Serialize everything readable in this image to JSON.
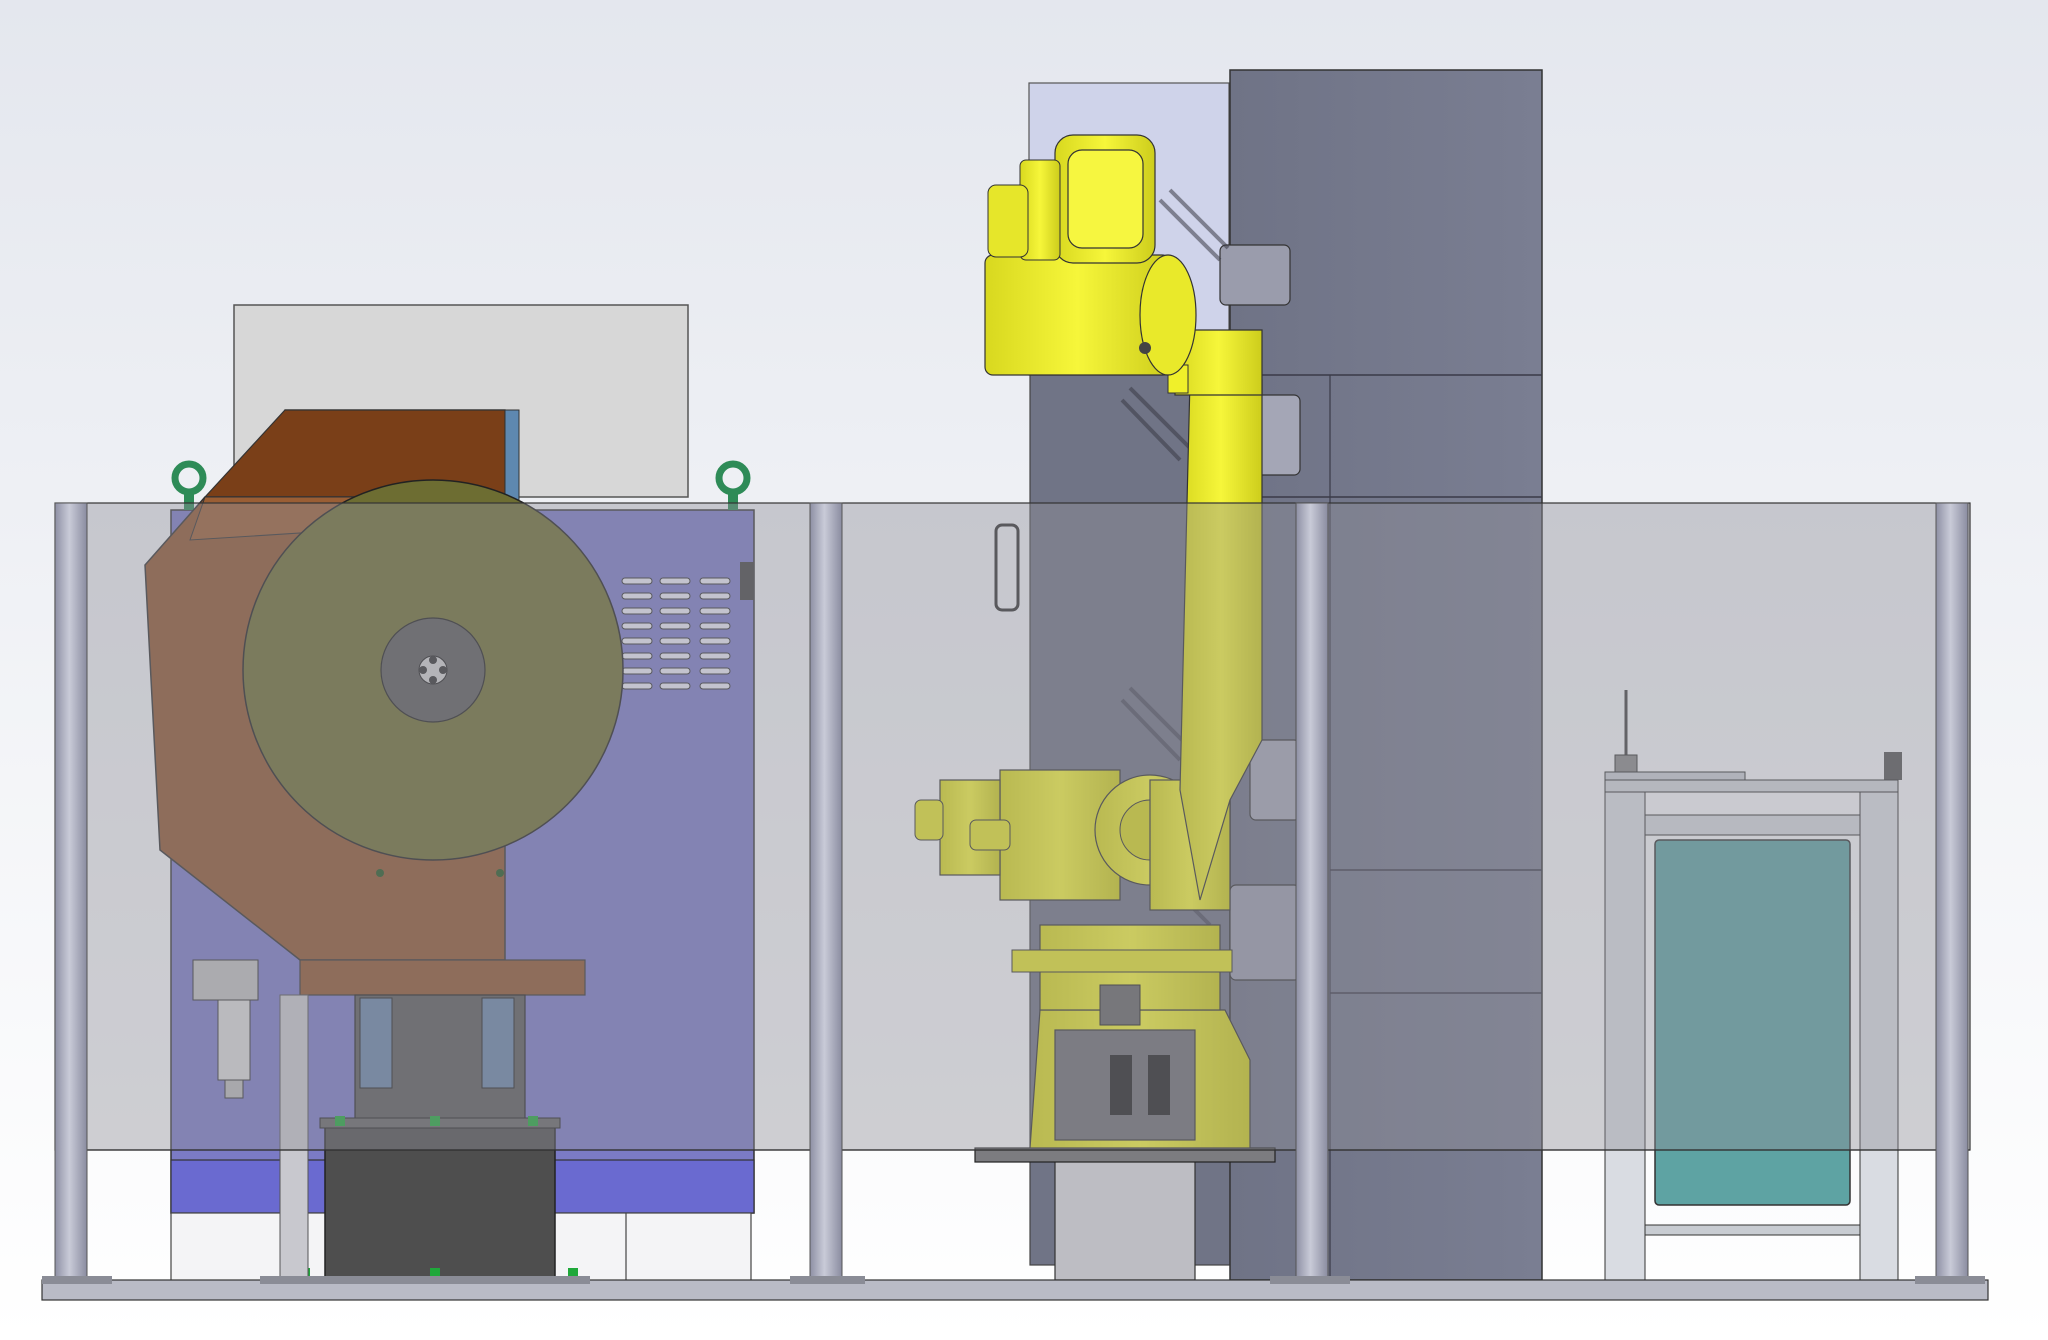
{
  "scene": {
    "description_shown": "",
    "colors": {
      "background_top": "#e6e9ef",
      "background_bottom": "#ffffff",
      "guard_panel": "#9ea0a8",
      "guard_post": "#a4a6b8",
      "press_cabinet": "#7b7bc4",
      "press_hood": "#8a4f2a",
      "press_hood_dark": "#6e3b1c",
      "coil_disc": "#6d6d32",
      "robot_yellow": "#f0f02a",
      "robot_yellow_dark": "#c8c81e",
      "robot_base_gray": "#7a7a80",
      "tall_cabinet": "#74788a",
      "tall_cabinet_light": "#cfd3e8",
      "outfeed_glass": "#5ea3a3",
      "outfeed_frame": "#c8ccd2",
      "floor_plate": "#b9bbc6",
      "eye_bolt": "#2e8b57",
      "foot_green": "#1fa83a"
    },
    "icons": [
      "eye-bolt-icon",
      "coil-hub-icon",
      "robot-motor-icon",
      "vent-slot-icon"
    ]
  }
}
